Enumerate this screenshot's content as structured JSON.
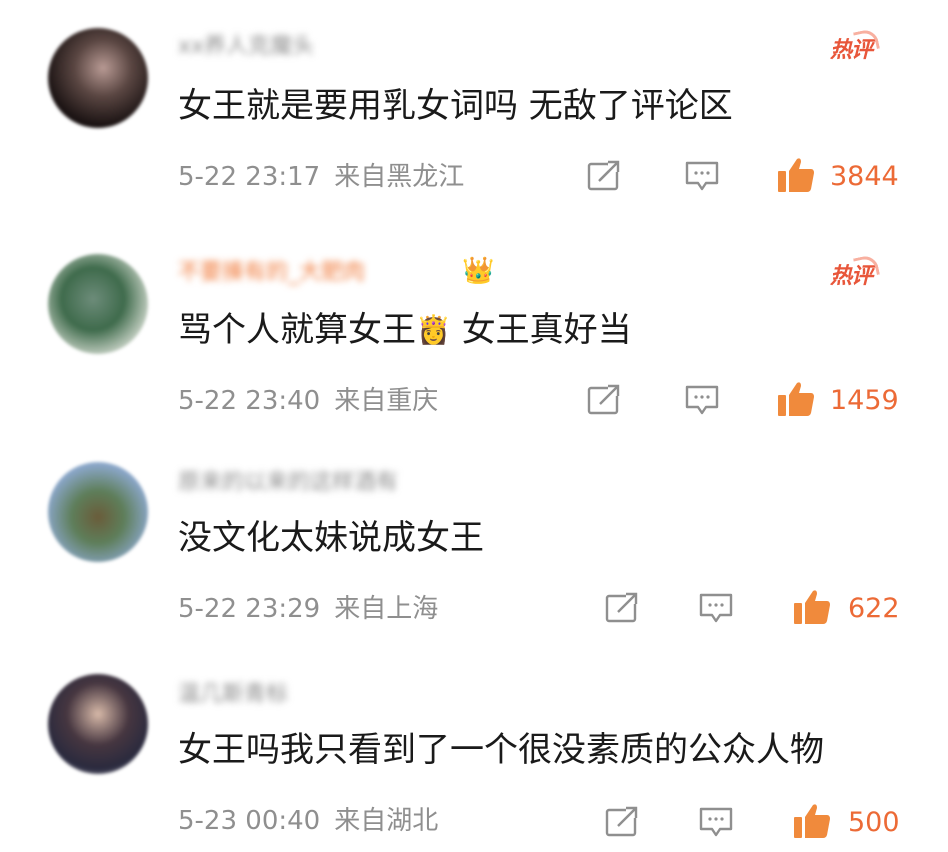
{
  "comments": [
    {
      "username": "xx养人克魔头",
      "text": "女王就是要用乳女词吗 无敌了评论区",
      "time": "5-22 23:17",
      "location": "来自黑龙江",
      "likes": "3844",
      "hot": "热评"
    },
    {
      "username": "不要揍有的_大肥肉",
      "text_a": "骂个人就算女王",
      "text_emoji": "👸",
      "text_b": "女王真好当",
      "time": "5-22 23:40",
      "location": "来自重庆",
      "likes": "1459",
      "hot": "热评",
      "crown": "👑"
    },
    {
      "username": "原来的以来的这样酒有",
      "text": "没文化太妹说成女王",
      "time": "5-22 23:29",
      "location": "来自上海",
      "likes": "622"
    },
    {
      "username": "温几斯青标",
      "text": "女王吗我只看到了一个很没素质的公众人物",
      "time": "5-23 00:40",
      "location": "来自湖北",
      "likes": "500"
    }
  ],
  "colors": {
    "accent": "#ec6a36",
    "hot_badge": "#e8563a",
    "meta_gray": "#8f8f8f",
    "text": "#1a1a1a"
  },
  "icons": [
    "share-icon",
    "reply-icon",
    "like-icon"
  ]
}
